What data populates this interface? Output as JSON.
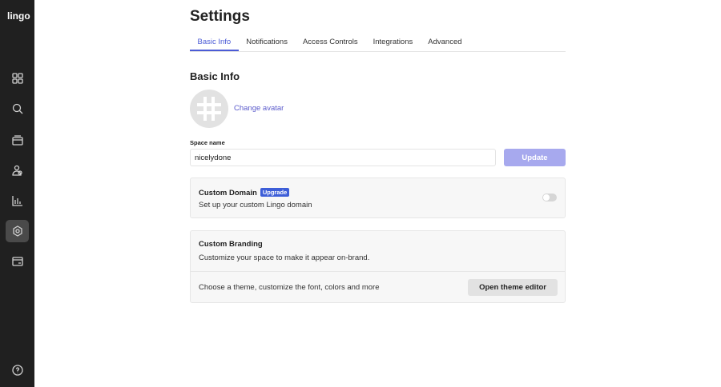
{
  "app": {
    "logo": "lingo"
  },
  "sidebar": {
    "items": [
      {
        "icon": "grid-icon"
      },
      {
        "icon": "search-icon"
      },
      {
        "icon": "archive-icon"
      },
      {
        "icon": "users-icon"
      },
      {
        "icon": "chart-icon"
      },
      {
        "icon": "gear-icon",
        "active": true
      },
      {
        "icon": "card-icon"
      },
      {
        "icon": "help-icon"
      }
    ]
  },
  "page": {
    "title": "Settings"
  },
  "tabs": [
    "Basic Info",
    "Notifications",
    "Access Controls",
    "Integrations",
    "Advanced"
  ],
  "basic": {
    "heading": "Basic Info",
    "change_avatar": "Change avatar",
    "space_label": "Space name",
    "space_value": "nicelydone",
    "update": "Update"
  },
  "domain": {
    "title": "Custom Domain",
    "badge": "Upgrade",
    "desc": "Set up your custom Lingo domain",
    "enabled": false
  },
  "branding": {
    "title": "Custom Branding",
    "desc": "Customize your space to make it appear on-brand.",
    "theme_desc": "Choose a theme, customize the font, colors and more",
    "theme_button": "Open theme editor"
  }
}
